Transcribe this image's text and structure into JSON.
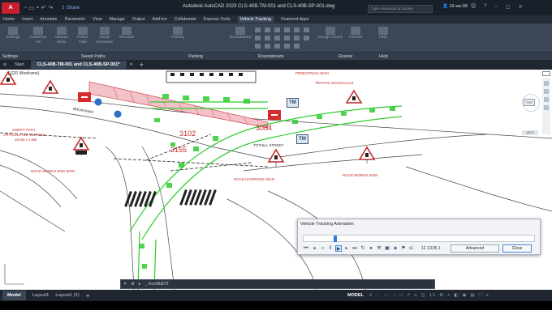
{
  "app": {
    "logo_text": "A",
    "window_title": "Autodesk AutoCAD 2023    CLS-40B-TM-001 and CLS-40B-SP-001.dwg",
    "share_label": "Share",
    "search_placeholder": "Type a keyword or phrase",
    "user": "16-sw-98"
  },
  "ribbon_tabs": [
    "Home",
    "Insert",
    "Annotate",
    "Parametric",
    "View",
    "Manage",
    "Output",
    "Add-ins",
    "Collaborate",
    "Express Tools",
    "Vehicle Tracking",
    "Featured Apps"
  ],
  "active_ribbon_tab": "Vehicle Tracking",
  "ribbon_buttons": [
    {
      "label": "Settings"
    },
    {
      "label": "AutoDrive Arc"
    },
    {
      "label": "Manual Drive"
    },
    {
      "label": "Follow Path"
    },
    {
      "label": "Swept Envelope"
    },
    {
      "label": "Simulate"
    },
    {
      "label": "Parking"
    },
    {
      "label": "Roundabout"
    },
    {
      "label": "Design Check"
    },
    {
      "label": "Animate"
    },
    {
      "label": "Help"
    }
  ],
  "ribbon_panels": [
    "Settings",
    "Swept Paths",
    "Parking",
    "Roundabouts",
    "Review",
    "Help"
  ],
  "doc_tabs": {
    "start": "Start",
    "active": "CLS-40B-TM-001 and CLS-40B-SP-001*"
  },
  "canvas": {
    "view_label": "[-][2D Wireframe]",
    "viewcube_top": "TOP",
    "wcs_label": "WCS",
    "tm_label": "TM",
    "dims": [
      "3102",
      "3084",
      "3155"
    ],
    "annotations": {
      "pedestrian": "PEDESTRIAN SIGN",
      "marshalls": "TRAFFIC MARSHALLS",
      "broadway": "BROADWAY",
      "swept": "SWEPT PATH",
      "artic": "ARTICULATED VEHICLE",
      "artic_dims": "16.5M x 2.5M",
      "tothill": "TOTHILL STREET",
      "roadworks_end": "ROAD WORKS END SIGN",
      "road_narrows": "ROAD NARROWS SIGN",
      "roadworks": "ROAD WORKS SIGN"
    }
  },
  "animation_dialog": {
    "title": "Vehicle Tracking Animation",
    "progress": 0.13,
    "speed": "x1",
    "frame": "12 1/195.1",
    "advanced_label": "Advanced",
    "close_label": "Close"
  },
  "command_line": {
    "prompt": "_ mvclAbIDIT"
  },
  "layout_tabs": [
    "Model",
    "Layout1",
    "Layout1 (2)"
  ],
  "status": {
    "model_label": "MODEL",
    "scale": "1:1"
  }
}
